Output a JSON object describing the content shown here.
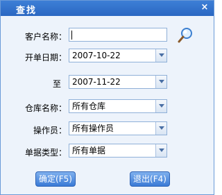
{
  "dialog": {
    "title": "查找",
    "close_label": "×"
  },
  "form": {
    "customer": {
      "label": "客户名称：",
      "value": ""
    },
    "start_date": {
      "label": "开单日期：",
      "value": "2007-10-22"
    },
    "end_date": {
      "label": "至",
      "value": "2007-11-22"
    },
    "warehouse": {
      "label": "仓库名称：",
      "value": "所有仓库"
    },
    "operator": {
      "label": "操作员：",
      "value": "所有操作员"
    },
    "doc_type": {
      "label": "单据类型：",
      "value": "所有单据"
    }
  },
  "buttons": {
    "confirm": "确定(F5)",
    "exit": "退出(F4)"
  },
  "colors": {
    "titlebar": "#2a67c2",
    "background": "#edf3fb",
    "button": "#3a7ad6"
  }
}
